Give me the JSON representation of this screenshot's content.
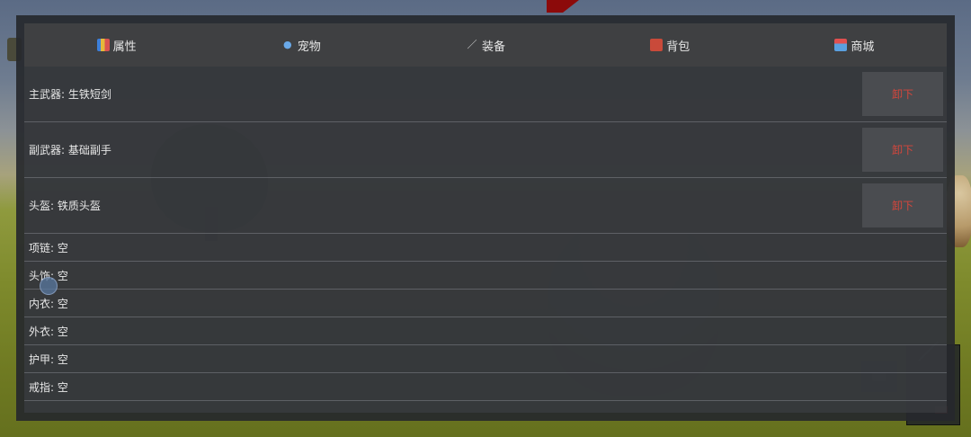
{
  "tabs": [
    {
      "label": "属性",
      "icon": "stats-chart-icon"
    },
    {
      "label": "宠物",
      "icon": "paw-icon"
    },
    {
      "label": "装备",
      "icon": "wand-icon"
    },
    {
      "label": "背包",
      "icon": "backpack-icon"
    },
    {
      "label": "商城",
      "icon": "shop-icon"
    }
  ],
  "equipment": [
    {
      "label": "主武器: 生铁短剑",
      "action": "卸下"
    },
    {
      "label": "副武器: 基础副手",
      "action": "卸下"
    },
    {
      "label": "头盔: 铁质头盔",
      "action": "卸下"
    }
  ],
  "empty_slots": [
    {
      "label": "项链: 空"
    },
    {
      "label": "头饰: 空"
    },
    {
      "label": "内衣: 空"
    },
    {
      "label": "外衣: 空"
    },
    {
      "label": "护甲: 空"
    },
    {
      "label": "戒指: 空"
    }
  ],
  "colors": {
    "unequip_text": "#d4463c",
    "panel_bg": "#3a3c40"
  }
}
